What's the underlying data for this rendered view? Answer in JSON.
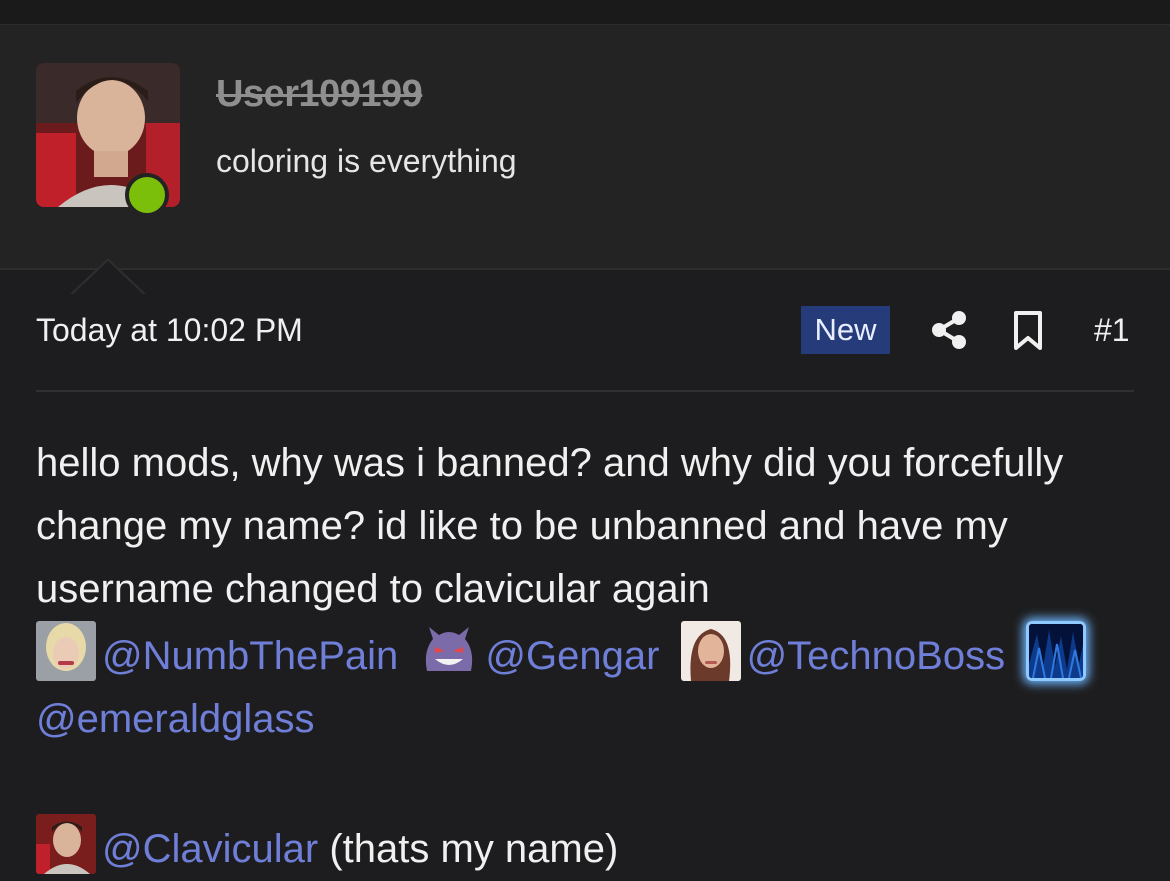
{
  "user": {
    "name": "User109199",
    "title": "coloring is everything",
    "status_color": "#7cbf0a"
  },
  "post": {
    "timestamp": "Today at 10:02 PM",
    "badge": "New",
    "number": "#1",
    "body_line1": "hello mods, why was i banned? and why did you forcefully change my name? id like to be unbanned and have my username changed to clavicular again",
    "mentions": [
      {
        "handle": "@NumbThePain",
        "avatar_icon": "blonde-woman-avatar"
      },
      {
        "handle": "@Gengar",
        "avatar_icon": "gengar-avatar"
      },
      {
        "handle": "@TechnoBoss",
        "avatar_icon": "woman-portrait-avatar"
      },
      {
        "handle": "@emeraldglass",
        "avatar_icon": "blue-abstract-avatar"
      }
    ],
    "last_mention": {
      "handle": "@Clavicular",
      "avatar_icon": "man-portrait-avatar"
    },
    "trailing_text": "(thats my name)"
  },
  "icons": {
    "share": "share-icon",
    "bookmark": "bookmark-icon"
  },
  "colors": {
    "badge_bg": "#253b7a",
    "mention": "#6f7fd8"
  }
}
